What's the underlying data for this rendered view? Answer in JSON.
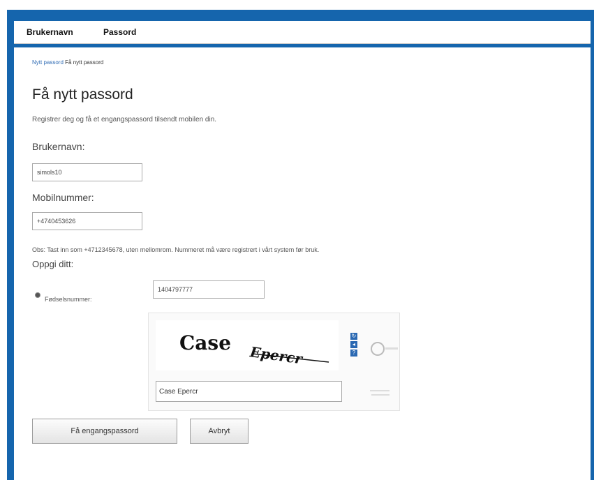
{
  "nav": {
    "username_tab": "Brukernavn",
    "password_tab": "Passord"
  },
  "breadcrumb": {
    "link": "Nytt passord",
    "current": "Få nytt passord"
  },
  "page": {
    "title": "Få nytt passord",
    "intro": "Registrer deg og få et engangspassord tilsendt mobilen din."
  },
  "form": {
    "username_label": "Brukernavn:",
    "username_value": "simols10",
    "mobile_label": "Mobilnummer:",
    "mobile_value": "+4740453626",
    "note": "Obs: Tast inn som +4712345678, uten mellomrom. Nummeret må være registrert i vårt system før bruk.",
    "provide_label": "Oppgi ditt:",
    "radio_label": "Fødselsnummer:",
    "birth_number_value": "1404797777"
  },
  "captcha": {
    "word1": "Case",
    "word2": "Epercr",
    "input_value": "Case Epercr",
    "refresh_icon": "refresh-icon",
    "audio_icon": "audio-icon",
    "help_icon": "help-icon"
  },
  "buttons": {
    "submit": "Få engangspassord",
    "cancel": "Avbryt"
  },
  "colors": {
    "frame": "#1565ad",
    "link": "#2e6bb4",
    "captcha_button": "#2a68b2"
  }
}
